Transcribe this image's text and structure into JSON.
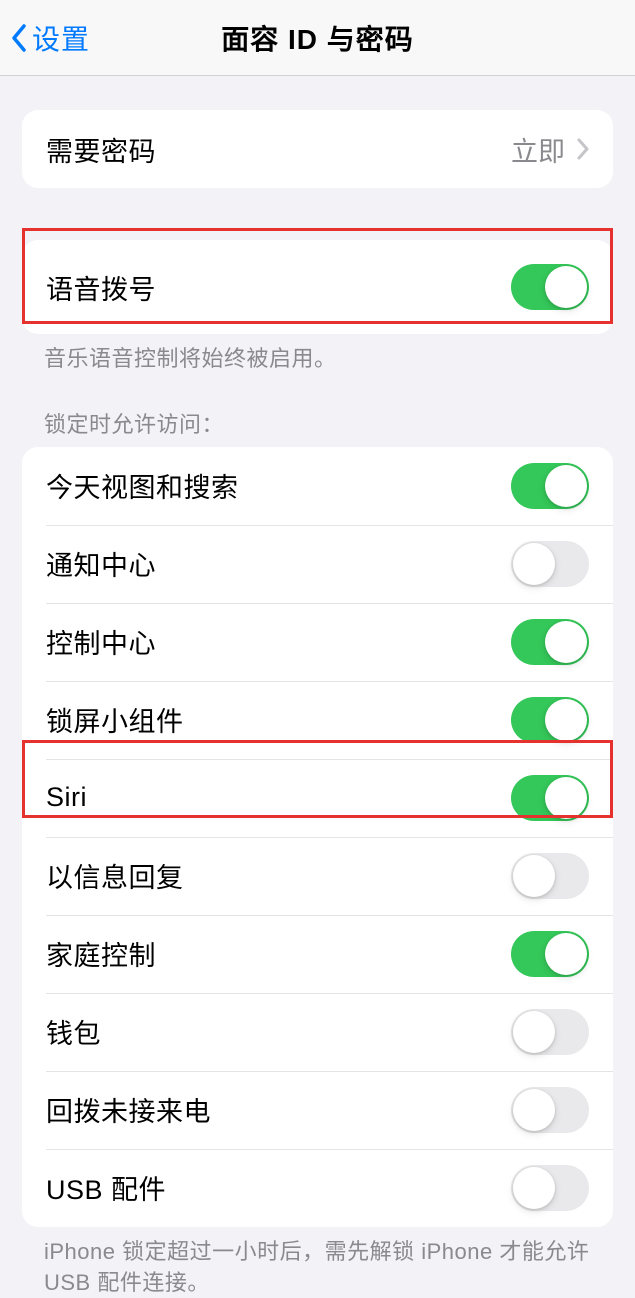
{
  "nav": {
    "back_label": "设置",
    "title": "面容 ID 与密码"
  },
  "require_passcode": {
    "label": "需要密码",
    "value": "立即"
  },
  "voice_dial": {
    "label": "语音拨号",
    "on": true,
    "footer": "音乐语音控制将始终被启用。"
  },
  "allow_access": {
    "header": "锁定时允许访问：",
    "items": [
      {
        "label": "今天视图和搜索",
        "on": true
      },
      {
        "label": "通知中心",
        "on": false
      },
      {
        "label": "控制中心",
        "on": true
      },
      {
        "label": "锁屏小组件",
        "on": true
      },
      {
        "label": "Siri",
        "on": true
      },
      {
        "label": "以信息回复",
        "on": false
      },
      {
        "label": "家庭控制",
        "on": true
      },
      {
        "label": "钱包",
        "on": false
      },
      {
        "label": "回拨未接来电",
        "on": false
      },
      {
        "label": "USB 配件",
        "on": false
      }
    ],
    "footer": "iPhone 锁定超过一小时后，需先解锁 iPhone 才能允许 USB 配件连接。"
  }
}
